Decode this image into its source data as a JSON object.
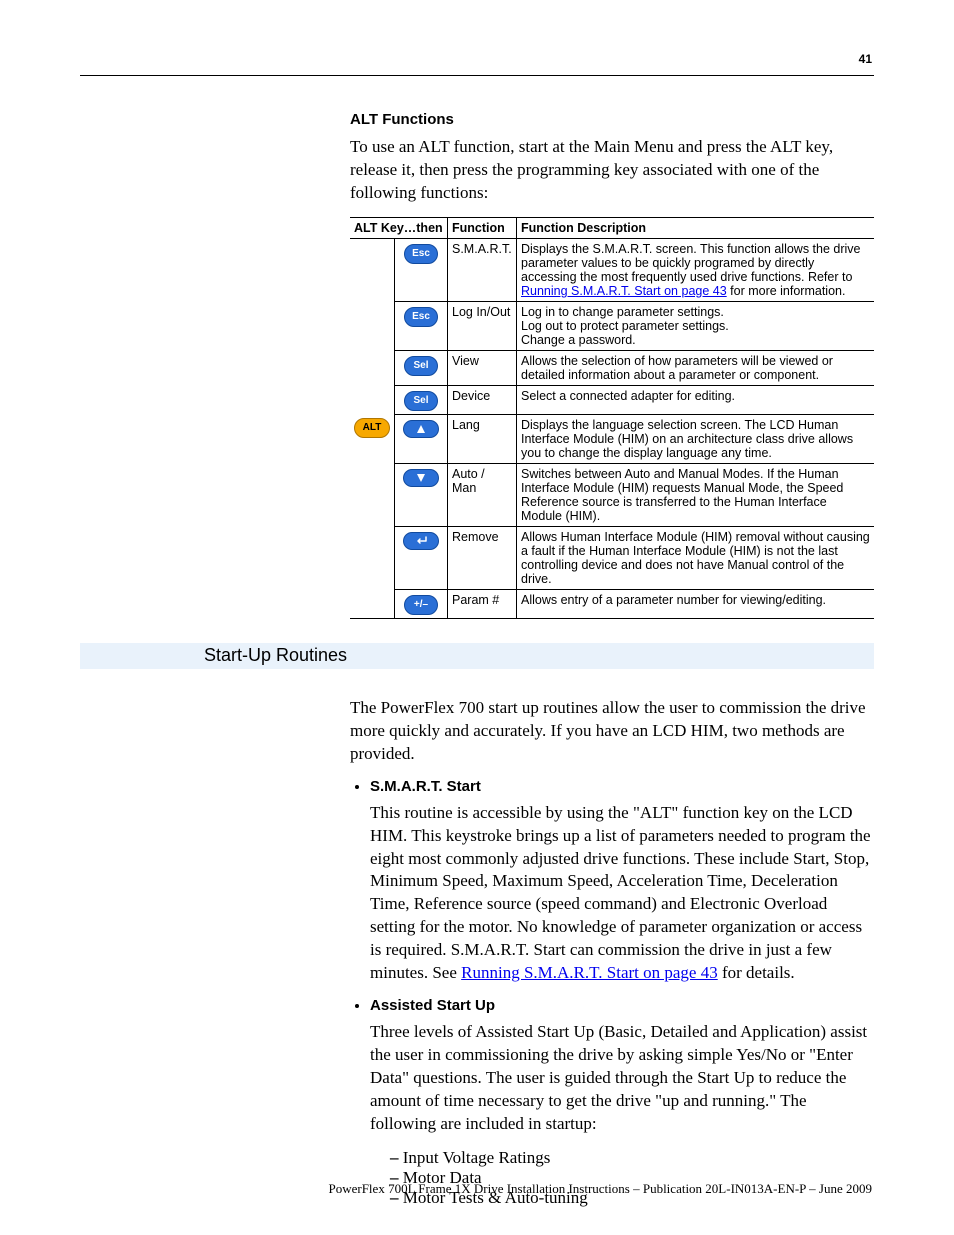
{
  "page_number": "41",
  "alt_functions": {
    "heading": "ALT Functions",
    "intro": "To use an ALT function, start at the Main Menu and press the ALT key, release it, then press the programming key associated with one of the following functions:",
    "table": {
      "headers": {
        "col1": "ALT Key…then",
        "col2": "Function",
        "col3": "Function Description"
      },
      "alt_key_label": "ALT",
      "rows": [
        {
          "key_label": "Esc",
          "function": "S.M.A.R.T.",
          "desc_pre": "Displays the S.M.A.R.T. screen. This function allows the drive parameter values to be quickly programed by directly accessing the most frequently used drive functions. Refer to ",
          "desc_link": "Running S.M.A.R.T. Start on page 43",
          "desc_post": " for more information."
        },
        {
          "key_label": "Esc",
          "function": "Log In/Out",
          "desc": "Log in to change parameter settings.\nLog out to protect parameter settings.\nChange a password."
        },
        {
          "key_label": "Sel",
          "function": "View",
          "desc": "Allows the selection of how parameters will be viewed or detailed information about a parameter or component."
        },
        {
          "key_label": "Sel",
          "function": "Device",
          "desc": "Select a connected adapter for editing."
        },
        {
          "key_label": "▲",
          "function": "Lang",
          "desc": "Displays the language selection screen. The LCD Human Interface Module (HIM) on an architecture class drive allows you to change the display language any time."
        },
        {
          "key_label": "▼",
          "function": "Auto / Man",
          "desc": "Switches between Auto and Manual Modes. If the Human Interface Module (HIM) requests Manual Mode, the Speed Reference source is transferred to the Human Interface Module (HIM)."
        },
        {
          "key_label": "↵",
          "function": "Remove",
          "desc": "Allows Human Interface Module (HIM) removal without causing a fault if the Human Interface Module (HIM) is not the last controlling device and does not have Manual control of the drive."
        },
        {
          "key_label": "+/–",
          "function": "Param #",
          "desc": "Allows entry of a parameter number for viewing/editing."
        }
      ]
    }
  },
  "startup": {
    "heading": "Start-Up Routines",
    "intro": "The PowerFlex 700 start up routines allow the user to commission the drive more quickly and accurately. If you have an LCD HIM, two methods are provided.",
    "items": [
      {
        "title": "S.M.A.R.T. Start",
        "body_pre": "This routine is accessible by using the \"ALT\" function key on the LCD HIM. This keystroke brings up a list of parameters needed to program the eight most commonly adjusted drive functions. These include Start, Stop, Minimum Speed, Maximum Speed, Acceleration Time, Deceleration Time, Reference source (speed command) and Electronic Overload setting for the motor. No knowledge of parameter organization or access is required. S.M.A.R.T. Start can commission the drive in just a few minutes. See ",
        "body_link": "Running S.M.A.R.T. Start on page 43",
        "body_post": " for details."
      },
      {
        "title": "Assisted Start Up",
        "body": "Three levels of Assisted Start Up (Basic, Detailed and Application) assist the user in commissioning the drive by asking simple Yes/No or \"Enter Data\" questions. The user is guided through the Start Up to reduce the amount of time necessary to get the drive \"up and running.\" The following are included in startup:",
        "sublist": [
          "Input Voltage Ratings",
          "Motor Data",
          "Motor Tests & Auto-tuning"
        ]
      }
    ]
  },
  "footer": "PowerFlex 700L Frame 1X Drive Installation Instructions – Publication 20L-IN013A-EN-P – June 2009"
}
